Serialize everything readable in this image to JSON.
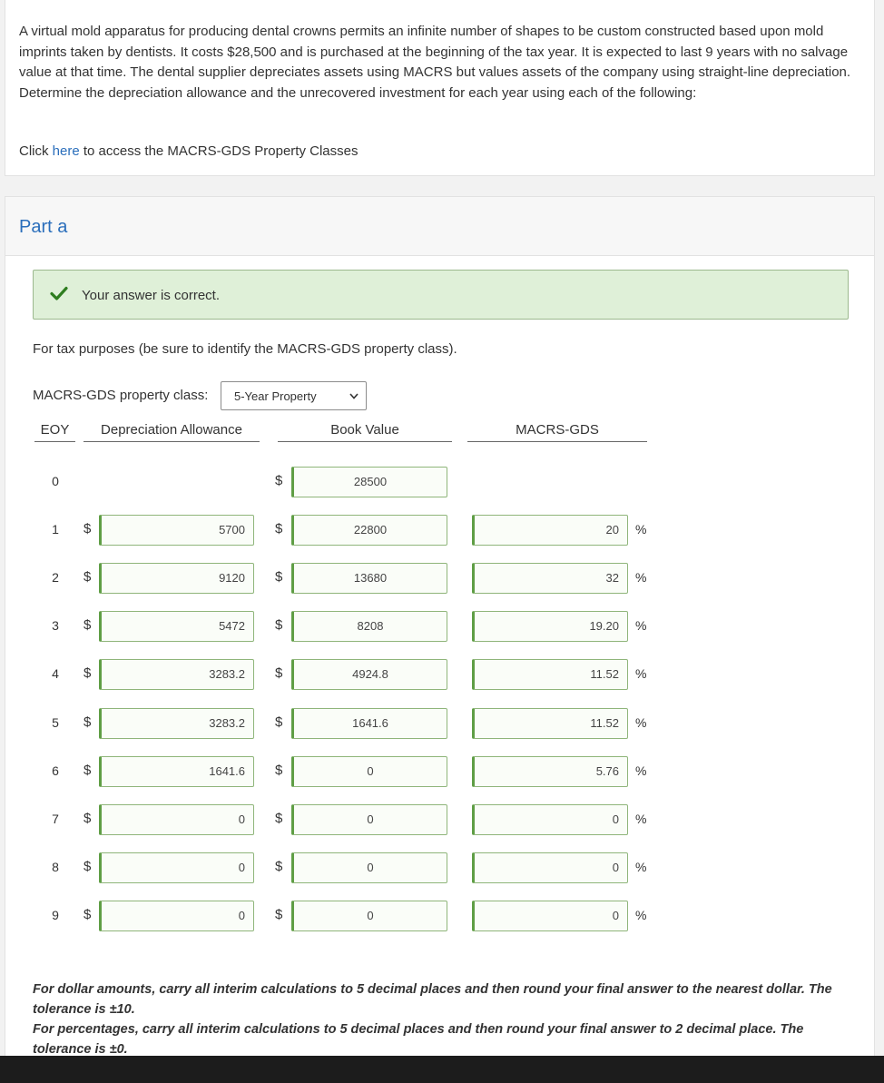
{
  "question": {
    "text": "A virtual mold apparatus for producing dental crowns permits an infinite number of shapes to be custom constructed based upon mold imprints taken by dentists. It costs $28,500 and is purchased at the beginning of the tax year. It is expected to last 9 years with no salvage value at that time. The dental supplier depreciates assets using MACRS but values assets of the company using straight-line depreciation. Determine the depreciation allowance and the unrecovered investment for each year using each of the following:",
    "access_prefix": "Click ",
    "access_link": "here",
    "access_suffix": " to access the MACRS-GDS Property Classes"
  },
  "part": {
    "title": "Part a",
    "banner": "Your answer is correct.",
    "instruction": "For tax purposes (be sure to identify the MACRS-GDS property class).",
    "class_label": "MACRS-GDS property class:",
    "class_value": "5-Year Property"
  },
  "table": {
    "headers": {
      "eoy": "EOY",
      "dep": "Depreciation Allowance",
      "book": "Book Value",
      "macrs": "MACRS-GDS"
    },
    "currency": "$",
    "percent": "%",
    "rows": [
      {
        "eoy": "0",
        "dep": null,
        "book": "28500",
        "macrs": null
      },
      {
        "eoy": "1",
        "dep": "5700",
        "book": "22800",
        "macrs": "20"
      },
      {
        "eoy": "2",
        "dep": "9120",
        "book": "13680",
        "macrs": "32"
      },
      {
        "eoy": "3",
        "dep": "5472",
        "book": "8208",
        "macrs": "19.20"
      },
      {
        "eoy": "4",
        "dep": "3283.2",
        "book": "4924.8",
        "macrs": "11.52"
      },
      {
        "eoy": "5",
        "dep": "3283.2",
        "book": "1641.6",
        "macrs": "11.52"
      },
      {
        "eoy": "6",
        "dep": "1641.6",
        "book": "0",
        "macrs": "5.76"
      },
      {
        "eoy": "7",
        "dep": "0",
        "book": "0",
        "macrs": "0"
      },
      {
        "eoy": "8",
        "dep": "0",
        "book": "0",
        "macrs": "0"
      },
      {
        "eoy": "9",
        "dep": "0",
        "book": "0",
        "macrs": "0"
      }
    ]
  },
  "notes": {
    "dollar": "For dollar amounts, carry all interim calculations to 5 decimal places and then round your final answer to the nearest dollar. The tolerance is ±10.",
    "percent": "For percentages, carry all interim calculations to 5 decimal places and then round your final answer to 2 decimal place. The tolerance is ±0."
  },
  "icons": {
    "check": "check-icon",
    "select": "chevron-down-icon"
  },
  "colors": {
    "link": "#2a6ebb",
    "success_bg": "#dff0d8",
    "check": "#2e7d1f"
  }
}
